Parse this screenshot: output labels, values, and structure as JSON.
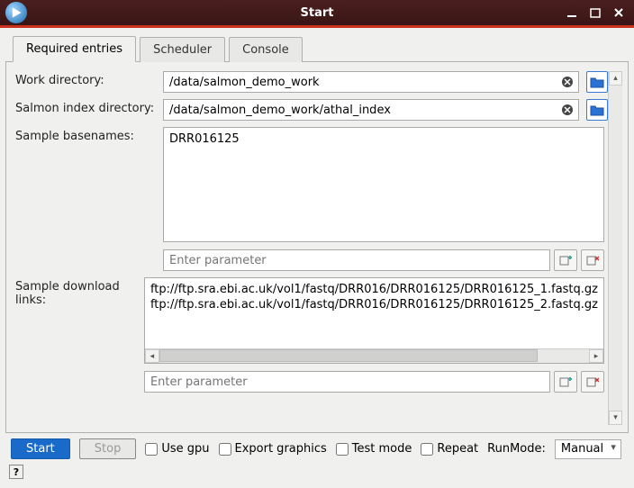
{
  "window": {
    "title": "Start"
  },
  "tabs": [
    {
      "label": "Required entries",
      "active": true
    },
    {
      "label": "Scheduler",
      "active": false
    },
    {
      "label": "Console",
      "active": false
    }
  ],
  "form": {
    "work_dir": {
      "label": "Work directory:",
      "value": "/data/salmon_demo_work"
    },
    "index_dir": {
      "label": "Salmon index directory:",
      "value": "/data/salmon_demo_work/athal_index"
    },
    "basenames": {
      "label": "Sample basenames:",
      "value": "DRR016125",
      "param_placeholder": "Enter parameter"
    },
    "downloads": {
      "label": "Sample download links:",
      "lines": [
        "ftp://ftp.sra.ebi.ac.uk/vol1/fastq/DRR016/DRR016125/DRR016125_1.fastq.gz",
        "ftp://ftp.sra.ebi.ac.uk/vol1/fastq/DRR016/DRR016125/DRR016125_2.fastq.gz"
      ],
      "param_placeholder": "Enter parameter"
    }
  },
  "bottom": {
    "start": "Start",
    "stop": "Stop",
    "use_gpu": "Use gpu",
    "export_graphics": "Export graphics",
    "test_mode": "Test mode",
    "repeat": "Repeat",
    "runmode_label": "RunMode:",
    "runmode_value": "Manual"
  },
  "help": "?"
}
